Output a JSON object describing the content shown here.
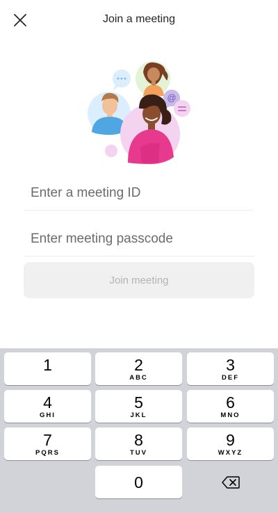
{
  "header": {
    "title": "Join a meeting",
    "close_icon": "close-icon"
  },
  "illustration": {
    "name": "people-meeting-illustration"
  },
  "form": {
    "meeting_id_placeholder": "Enter a meeting ID",
    "meeting_id_value": "",
    "passcode_placeholder": "Enter meeting passcode",
    "passcode_value": "",
    "join_button_label": "Join meeting"
  },
  "keyboard": {
    "keys": [
      {
        "num": "1",
        "letters": ""
      },
      {
        "num": "2",
        "letters": "ABC"
      },
      {
        "num": "3",
        "letters": "DEF"
      },
      {
        "num": "4",
        "letters": "GHI"
      },
      {
        "num": "5",
        "letters": "JKL"
      },
      {
        "num": "6",
        "letters": "MNO"
      },
      {
        "num": "7",
        "letters": "PQRS"
      },
      {
        "num": "8",
        "letters": "TUV"
      },
      {
        "num": "9",
        "letters": "WXYZ"
      },
      {
        "num": "0",
        "letters": ""
      }
    ],
    "delete_icon": "backspace-icon"
  },
  "colors": {
    "keyboard_bg": "#d1d3d9",
    "button_disabled_bg": "#f0f0f0",
    "button_disabled_text": "#b3b3b3"
  }
}
